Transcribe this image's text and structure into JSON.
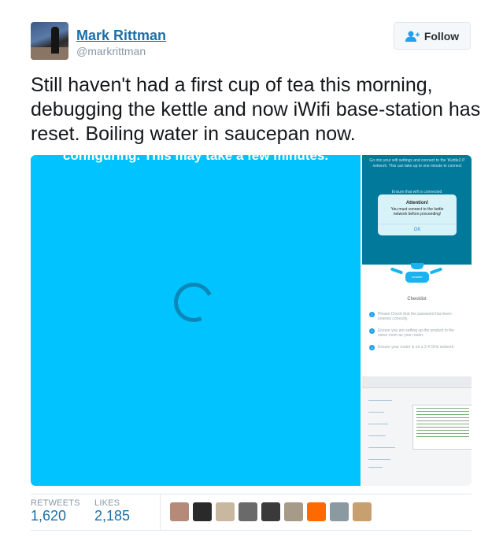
{
  "author": {
    "name": "Mark Rittman",
    "handle": "@markrittman"
  },
  "follow_button": {
    "label": "Follow",
    "icon": "add-user-icon"
  },
  "tweet": {
    "text": "Still haven't had a first cup of tea this morning, debugging the kettle and now iWifi base-station has reset. Boiling water in saucepan now."
  },
  "media": {
    "main": {
      "caption": "configuring. This may take a few minutes.",
      "background": "#00c3ff"
    },
    "thumb1": {
      "message": "Go into your wifi settings and connect to the 'iKettle2.0' network. This can take up to one minute to connect",
      "behind_text": "Ensure that wifi is connected",
      "dialog_title": "Attention!",
      "dialog_text": "You must connect to the kettle network before proceeding!",
      "dialog_button": "OK"
    },
    "thumb2": {
      "robot_label": "smarter",
      "title": "Checklist",
      "items": [
        {
          "num": "1",
          "text": "Please Check that the password has been entered correctly."
        },
        {
          "num": "2",
          "text": "Ensure you are setting up the product in the same room as your router."
        },
        {
          "num": "3",
          "text": "Ensure your router is on a 2.4 GHz network."
        }
      ]
    }
  },
  "stats": {
    "retweets_label": "RETWEETS",
    "retweets": "1,620",
    "likes_label": "LIKES",
    "likes": "2,185"
  },
  "likers": [
    "#b58a78",
    "#2a2a2a",
    "#c9b8a0",
    "#6a6a6a",
    "#3a3a3a",
    "#a89a88",
    "#ff6a00",
    "#8a9aa0",
    "#c8a070"
  ]
}
